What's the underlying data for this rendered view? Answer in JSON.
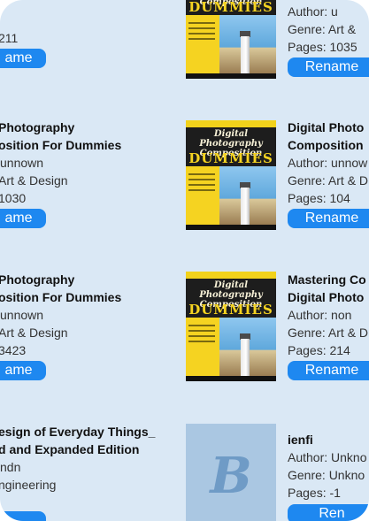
{
  "books": [
    {
      "id": "left-1",
      "title_lines": [],
      "author": "",
      "genre": "",
      "pages": "211",
      "rename_label": "ame"
    },
    {
      "id": "right-1",
      "title_lines": [],
      "author": "Author: u",
      "genre": "Genre: Art &",
      "pages": "Pages: 1035",
      "rename_label": "Rename",
      "cover": {
        "title": "Digital Photography Composition",
        "brand": "DUMMIES"
      }
    },
    {
      "id": "left-2",
      "title_lines": [
        "Photography",
        "osition For Dummies"
      ],
      "author": "unnown",
      "genre": "Art & Design",
      "pages": "1030",
      "rename_label": "ame"
    },
    {
      "id": "right-2",
      "title_lines": [
        "Digital Photo",
        "Composition"
      ],
      "author": "Author: unnow",
      "genre": "Genre: Art & D",
      "pages": "Pages: 104",
      "rename_label": "Rename",
      "cover": {
        "title": "Digital Photography Composition",
        "brand": "DUMMIES"
      }
    },
    {
      "id": "left-3",
      "title_lines": [
        "Photography",
        "osition For Dummies"
      ],
      "author": "unnown",
      "genre": "Art & Design",
      "pages": "3423",
      "rename_label": "ame"
    },
    {
      "id": "right-3",
      "title_lines": [
        "Mastering Co",
        "Digital Photo"
      ],
      "author": "Author: non",
      "genre": "Genre: Art & D",
      "pages": "Pages: 214",
      "rename_label": "Rename",
      "cover": {
        "title": "Digital Photography Composition",
        "brand": "DUMMIES"
      }
    },
    {
      "id": "left-4",
      "title_lines": [
        "esign of Everyday Things_",
        "d and Expanded Edition"
      ],
      "author": "ndn",
      "genre": "ngineering",
      "pages": "",
      "rename_label": ""
    },
    {
      "id": "right-4",
      "title_lines": [
        "ienfi"
      ],
      "author": "Author: Unkno",
      "genre": "Genre: Unkno",
      "pages": "Pages: -1",
      "rename_label": "Ren",
      "cover": {
        "placeholder_letter": "B"
      }
    }
  ]
}
